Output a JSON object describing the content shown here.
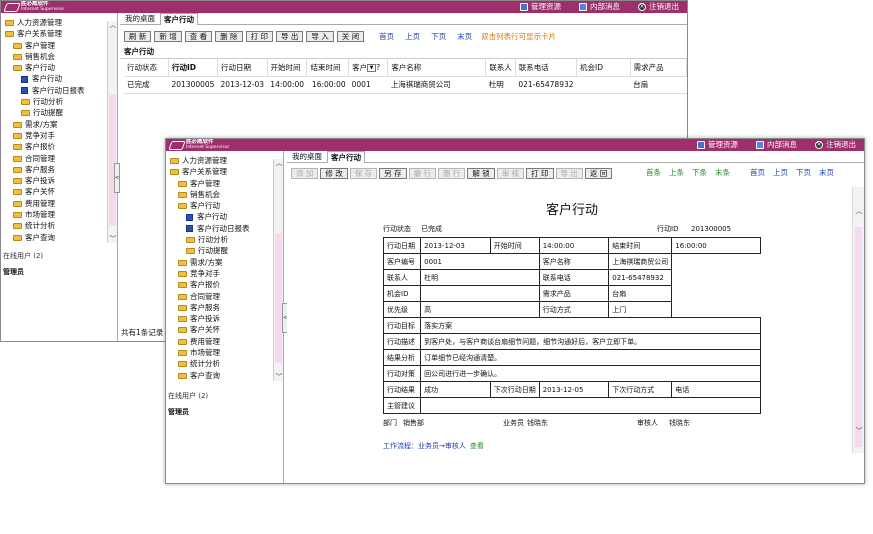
{
  "app": {
    "logo_cn": "胜必威软件",
    "logo_en": "Internet Supervisor",
    "top_links": [
      "管理资源",
      "内部消息",
      "注销退出"
    ]
  },
  "sidebar": {
    "items": [
      {
        "label": "人力资源管理",
        "icon": "folder-icon",
        "level": 0
      },
      {
        "label": "客户关系管理",
        "icon": "folder-icon",
        "level": 0
      },
      {
        "label": "客户管理",
        "icon": "folder-icon",
        "level": 1
      },
      {
        "label": "销售机会",
        "icon": "folder-icon",
        "level": 1
      },
      {
        "label": "客户行动",
        "icon": "folder-icon",
        "level": 1
      },
      {
        "label": "客户行动",
        "icon": "grid-icon",
        "level": 2
      },
      {
        "label": "客户行动日报表",
        "icon": "grid-icon",
        "level": 2
      },
      {
        "label": "行动分析",
        "icon": "folder-icon",
        "level": 2
      },
      {
        "label": "行动提醒",
        "icon": "folder-icon",
        "level": 2
      },
      {
        "label": "需求/方案",
        "icon": "folder-icon",
        "level": 1
      },
      {
        "label": "竞争对手",
        "icon": "folder-icon",
        "level": 1
      },
      {
        "label": "客户报价",
        "icon": "folder-icon",
        "level": 1
      },
      {
        "label": "合同管理",
        "icon": "folder-icon",
        "level": 1
      },
      {
        "label": "客户服务",
        "icon": "folder-icon",
        "level": 1
      },
      {
        "label": "客户投诉",
        "icon": "folder-icon",
        "level": 1
      },
      {
        "label": "客户关怀",
        "icon": "folder-icon",
        "level": 1
      },
      {
        "label": "费用管理",
        "icon": "folder-icon",
        "level": 1
      },
      {
        "label": "市场管理",
        "icon": "folder-icon",
        "level": 1
      },
      {
        "label": "统计分析",
        "icon": "folder-icon",
        "level": 1
      },
      {
        "label": "客户查询",
        "icon": "folder-icon",
        "level": 1
      }
    ],
    "online_label": "在线用户 (2)",
    "online_user": "管理员"
  },
  "w1": {
    "tabs": [
      "我的桌面",
      "客户行动"
    ],
    "buttons": [
      "刷 新",
      "新 增",
      "查 看",
      "删 除",
      "打 印",
      "导 出",
      "导 入",
      "关 闭"
    ],
    "nav": [
      "首页",
      "上页",
      "下页",
      "末页"
    ],
    "hint": "双击列表行可显示卡片",
    "section": "客户行动",
    "columns": [
      "行动状态",
      "行动ID",
      "行动日期",
      "开始时间",
      "结束时间",
      "客户",
      "?",
      "客户名称",
      "联系人",
      "联系电话",
      "机会ID",
      "需求产品"
    ],
    "row": [
      "已完成",
      "201300005",
      "2013-12-03",
      "14:00:00",
      "16:00:00",
      "0001",
      "",
      "上海祺瑞商贸公司",
      "杜明",
      "021-65478932",
      "",
      "台扇"
    ],
    "footer": "共有1条记录"
  },
  "w2": {
    "tabs": [
      "我的桌面",
      "客户行动"
    ],
    "buttons": [
      {
        "label": "添 加",
        "disabled": true
      },
      {
        "label": "修 改",
        "disabled": false
      },
      {
        "label": "保 存",
        "disabled": true
      },
      {
        "label": "另 存",
        "disabled": false
      },
      {
        "label": "撤 行",
        "disabled": true
      },
      {
        "label": "删 行",
        "disabled": true
      },
      {
        "label": "解 锁",
        "disabled": false
      },
      {
        "label": "审 核",
        "disabled": true
      },
      {
        "label": "打 印",
        "disabled": false
      },
      {
        "label": "导 出",
        "disabled": true
      },
      {
        "label": "返 回",
        "disabled": false
      }
    ],
    "rec_nav": [
      "首条",
      "上条",
      "下条",
      "末条"
    ],
    "page_nav": [
      "首页",
      "上页",
      "下页",
      "末页"
    ],
    "form_title": "客户行动",
    "status_label": "行动状态",
    "status_value": "已完成",
    "id_label": "行动ID",
    "id_value": "201300005",
    "rows": [
      [
        [
          "行动日期",
          "2013-12-03"
        ],
        [
          "开始时间",
          "14:00:00"
        ],
        [
          "结束时间",
          "16:00:00"
        ]
      ],
      [
        [
          "客户编号",
          "0001"
        ],
        [
          "客户名称",
          "上海祺瑞商贸公司"
        ]
      ],
      [
        [
          "联系人",
          "杜明"
        ],
        [
          "联系电话",
          "021-65478932"
        ]
      ],
      [
        [
          "机会ID",
          ""
        ],
        [
          "需求产品",
          "台扇"
        ]
      ],
      [
        [
          "优先级",
          "高"
        ],
        [
          "行动方式",
          "上门"
        ]
      ],
      [
        [
          "行动目标",
          "落实方案"
        ]
      ],
      [
        [
          "行动描述",
          "到客户处，与客户商谈台扇细节问题，细节沟通好后，客户立即下单。"
        ]
      ],
      [
        [
          "结果分析",
          "订单细节已经沟通清楚。"
        ]
      ],
      [
        [
          "行动对策",
          "回公司进行进一步确认。"
        ]
      ],
      [
        [
          "行动结果",
          "成功"
        ],
        [
          "下次行动日期",
          "2013-12-05"
        ],
        [
          "下次行动方式",
          "电话"
        ]
      ],
      [
        [
          "主管建议",
          ""
        ]
      ]
    ],
    "sig": {
      "dept_label": "部门",
      "dept": "销售部",
      "staff_label": "业务员",
      "staff": "钱晓东",
      "auditor_label": "审核人",
      "auditor": "钱晓东"
    },
    "flow_label": "工作流程：业务员→审核人",
    "flow_link": "查看"
  }
}
